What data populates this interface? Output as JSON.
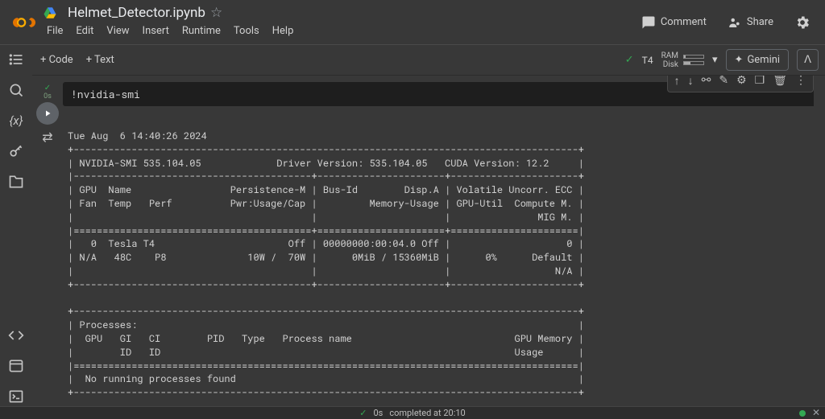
{
  "header": {
    "filename": "Helmet_Detector.ipynb",
    "menus": [
      "File",
      "Edit",
      "View",
      "Insert",
      "Runtime",
      "Tools",
      "Help"
    ],
    "comment": "Comment",
    "share": "Share"
  },
  "toolbar": {
    "code": "+ Code",
    "text": "+ Text",
    "gpu_label": "T4",
    "ram_label": "RAM",
    "disk_label": "Disk",
    "gemini": "Gemini"
  },
  "cell": {
    "exec_time": "0s",
    "code": "!nvidia-smi",
    "output": "Tue Aug  6 14:40:26 2024       \n+---------------------------------------------------------------------------------------+\n| NVIDIA-SMI 535.104.05             Driver Version: 535.104.05   CUDA Version: 12.2     |\n|-----------------------------------------+----------------------+----------------------+\n| GPU  Name                 Persistence-M | Bus-Id        Disp.A | Volatile Uncorr. ECC |\n| Fan  Temp   Perf          Pwr:Usage/Cap |         Memory-Usage | GPU-Util  Compute M. |\n|                                         |                      |               MIG M. |\n|=========================================+======================+======================|\n|   0  Tesla T4                       Off | 00000000:00:04.0 Off |                    0 |\n| N/A   48C    P8              10W /  70W |      0MiB / 15360MiB |      0%      Default |\n|                                         |                      |                  N/A |\n+-----------------------------------------+----------------------+----------------------+\n                                                                                         \n+---------------------------------------------------------------------------------------+\n| Processes:                                                                            |\n|  GPU   GI   CI        PID   Type   Process name                            GPU Memory |\n|        ID   ID                                                             Usage      |\n|=======================================================================================|\n|  No running processes found                                                           |\n+---------------------------------------------------------------------------------------+"
  },
  "status": {
    "time": "0s",
    "completed": "completed at 20:10"
  }
}
